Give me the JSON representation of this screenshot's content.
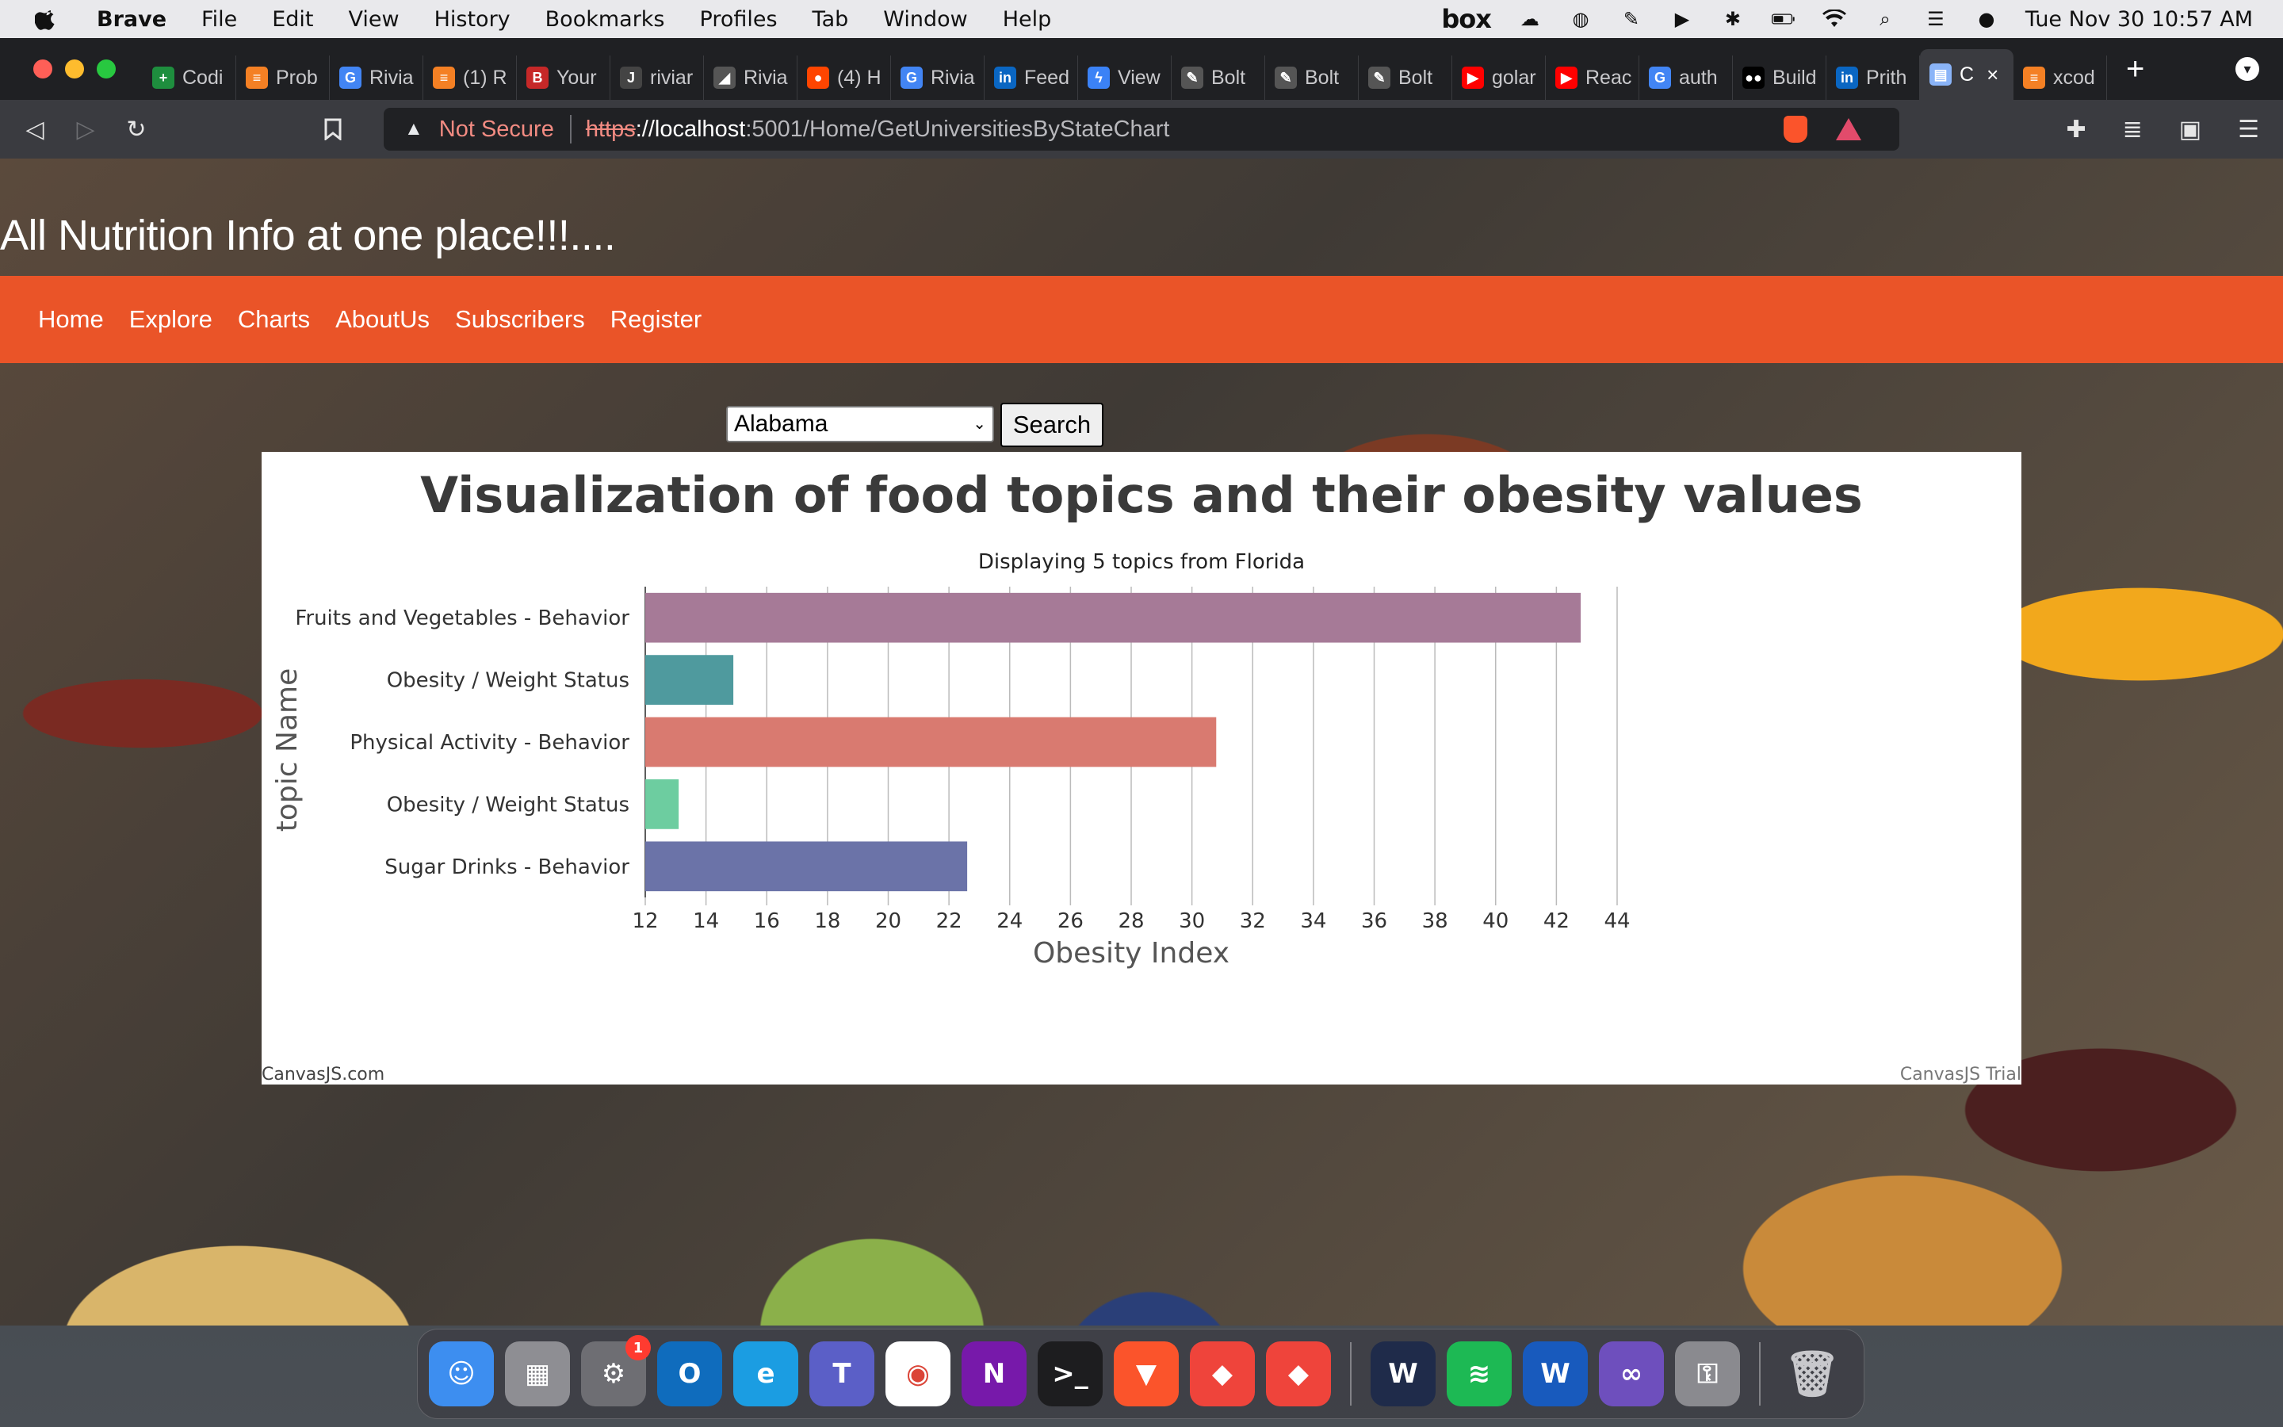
{
  "menubar": {
    "app_name": "Brave",
    "items": [
      "File",
      "Edit",
      "View",
      "History",
      "Bookmarks",
      "Profiles",
      "Tab",
      "Window",
      "Help"
    ],
    "box_label": "box",
    "clock": "Tue Nov 30  10:57 AM"
  },
  "tabs": [
    {
      "label": "Codi",
      "icon": "sheets-icon",
      "color": "#1e8e3e"
    },
    {
      "label": "Prob",
      "icon": "stack-icon",
      "color": "#f48024"
    },
    {
      "label": "Rivia",
      "icon": "google-icon",
      "color": "#4285f4"
    },
    {
      "label": "(1) R",
      "icon": "stack-icon",
      "color": "#f48024"
    },
    {
      "label": "Your",
      "icon": "b-icon",
      "color": "#c62828"
    },
    {
      "label": "riviar",
      "icon": "journal-icon",
      "color": "#444444"
    },
    {
      "label": "Rivia",
      "icon": "chart-icon",
      "color": "#555555"
    },
    {
      "label": "(4) H",
      "icon": "reddit-icon",
      "color": "#ff4500"
    },
    {
      "label": "Rivia",
      "icon": "google-icon",
      "color": "#4285f4"
    },
    {
      "label": "Feed",
      "icon": "linkedin-icon",
      "color": "#0a66c2"
    },
    {
      "label": "View",
      "icon": "bolt-icon",
      "color": "#3b82f6"
    },
    {
      "label": "Bolt",
      "icon": "pen-icon",
      "color": "#555555"
    },
    {
      "label": "Bolt",
      "icon": "pen-icon",
      "color": "#555555"
    },
    {
      "label": "Bolt",
      "icon": "pen-icon",
      "color": "#555555"
    },
    {
      "label": "golar",
      "icon": "youtube-icon",
      "color": "#ff0000"
    },
    {
      "label": "Reac",
      "icon": "youtube-icon",
      "color": "#ff0000"
    },
    {
      "label": "auth",
      "icon": "google-icon",
      "color": "#4285f4"
    },
    {
      "label": "Build",
      "icon": "medium-icon",
      "color": "#000000"
    },
    {
      "label": "Prith",
      "icon": "linkedin-icon",
      "color": "#0a66c2"
    },
    {
      "label": "C",
      "icon": "doc-icon",
      "color": "#8ab4f8",
      "active": true
    },
    {
      "label": "xcod",
      "icon": "stack-icon",
      "color": "#f48024"
    }
  ],
  "toolbar": {
    "not_secure": "Not Secure",
    "url_scheme": "https",
    "url_host": "://localhost",
    "url_path": ":5001/Home/GetUniversitiesByStateChart"
  },
  "page": {
    "hero_title": "All Nutrition Info at one place!!!....",
    "nav": [
      "Home",
      "Explore",
      "Charts",
      "AboutUs",
      "Subscribers",
      "Register"
    ],
    "state_select_value": "Alabama",
    "search_label": "Search",
    "accent_color": "#ea5428"
  },
  "chart_data": {
    "type": "bar",
    "orientation": "horizontal",
    "title": "Visualization of food topics and their obesity values",
    "subtitle": "Displaying 5 topics from Florida",
    "xlabel": "Obesity Index",
    "ylabel": "topic Name",
    "categories": [
      "Fruits and Vegetables - Behavior",
      "Obesity / Weight Status",
      "Physical Activity - Behavior",
      "Obesity / Weight Status",
      "Sugar Drinks - Behavior"
    ],
    "values": [
      42.8,
      14.9,
      30.8,
      13.1,
      22.6
    ],
    "colors": [
      "#a67a97",
      "#4f9a9e",
      "#d97a70",
      "#6dcda0",
      "#6b73a8"
    ],
    "xlim": [
      12,
      44
    ],
    "xticks": [
      12,
      14,
      16,
      18,
      20,
      22,
      24,
      26,
      28,
      30,
      32,
      34,
      36,
      38,
      40,
      42,
      44
    ],
    "grid": true,
    "credit_left": "CanvasJS.com",
    "credit_right": "CanvasJS Trial"
  },
  "dock": {
    "settings_badge": "1",
    "apps": [
      {
        "name": "finder-icon",
        "color": "#3d8ef0",
        "glyph": "☺"
      },
      {
        "name": "launchpad-icon",
        "color": "#8e8e93",
        "glyph": "▦"
      },
      {
        "name": "system-preferences-icon",
        "color": "#6e6e73",
        "glyph": "⚙"
      },
      {
        "name": "outlook-icon",
        "color": "#0f6cbd",
        "glyph": "O"
      },
      {
        "name": "edge-icon",
        "color": "#1b9de2",
        "glyph": "e"
      },
      {
        "name": "teams-icon",
        "color": "#5b5fc7",
        "glyph": "T"
      },
      {
        "name": "chrome-icon",
        "color": "#ffffff",
        "glyph": "◉"
      },
      {
        "name": "onenote-icon",
        "color": "#7719aa",
        "glyph": "N"
      },
      {
        "name": "terminal-icon",
        "color": "#1d1d1f",
        "glyph": ">_"
      },
      {
        "name": "brave-icon",
        "color": "#fb542b",
        "glyph": "▼"
      },
      {
        "name": "anydesk-icon",
        "color": "#ef443b",
        "glyph": "◆"
      },
      {
        "name": "anydesk-icon-2",
        "color": "#ef443b",
        "glyph": "◆"
      }
    ],
    "apps_right": [
      {
        "name": "webex-icon",
        "color": "#1f2b4a",
        "glyph": "W"
      },
      {
        "name": "spotify-icon",
        "color": "#1db954",
        "glyph": "≋"
      },
      {
        "name": "word-icon",
        "color": "#185abd",
        "glyph": "W"
      },
      {
        "name": "visual-studio-icon",
        "color": "#6e4fbd",
        "glyph": "∞"
      },
      {
        "name": "keychain-icon",
        "color": "#8a8a8f",
        "glyph": "⚿"
      }
    ],
    "trash_name": "trash-icon"
  }
}
